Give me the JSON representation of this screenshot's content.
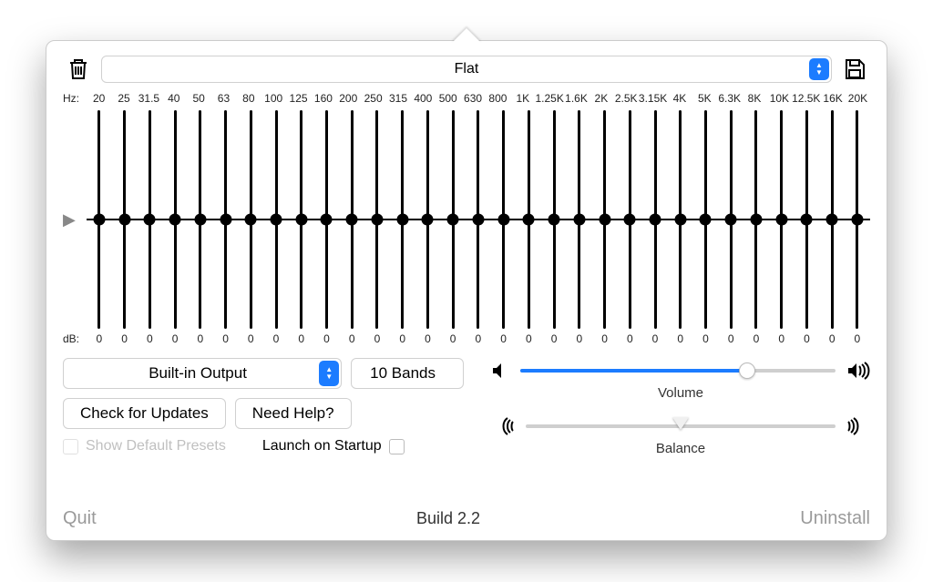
{
  "preset": {
    "selected": "Flat"
  },
  "hz_label": "Hz:",
  "db_label": "dB:",
  "frequencies": [
    "20",
    "25",
    "31.5",
    "40",
    "50",
    "63",
    "80",
    "100",
    "125",
    "160",
    "200",
    "250",
    "315",
    "400",
    "500",
    "630",
    "800",
    "1K",
    "1.25K",
    "1.6K",
    "2K",
    "2.5K",
    "3.15K",
    "4K",
    "5K",
    "6.3K",
    "8K",
    "10K",
    "12.5K",
    "16K",
    "20K"
  ],
  "gains": [
    "0",
    "0",
    "0",
    "0",
    "0",
    "0",
    "0",
    "0",
    "0",
    "0",
    "0",
    "0",
    "0",
    "0",
    "0",
    "0",
    "0",
    "0",
    "0",
    "0",
    "0",
    "0",
    "0",
    "0",
    "0",
    "0",
    "0",
    "0",
    "0",
    "0",
    "0"
  ],
  "output": {
    "selected": "Built-in Output"
  },
  "bands": {
    "selected": "10 Bands"
  },
  "buttons": {
    "check_updates": "Check for Updates",
    "need_help": "Need Help?"
  },
  "checks": {
    "show_default_presets": "Show Default Presets",
    "launch_on_startup": "Launch on Startup"
  },
  "sliders": {
    "volume": {
      "label": "Volume",
      "percent": 72
    },
    "balance": {
      "label": "Balance",
      "percent": 50
    }
  },
  "footer": {
    "quit": "Quit",
    "build": "Build 2.2",
    "uninstall": "Uninstall"
  }
}
